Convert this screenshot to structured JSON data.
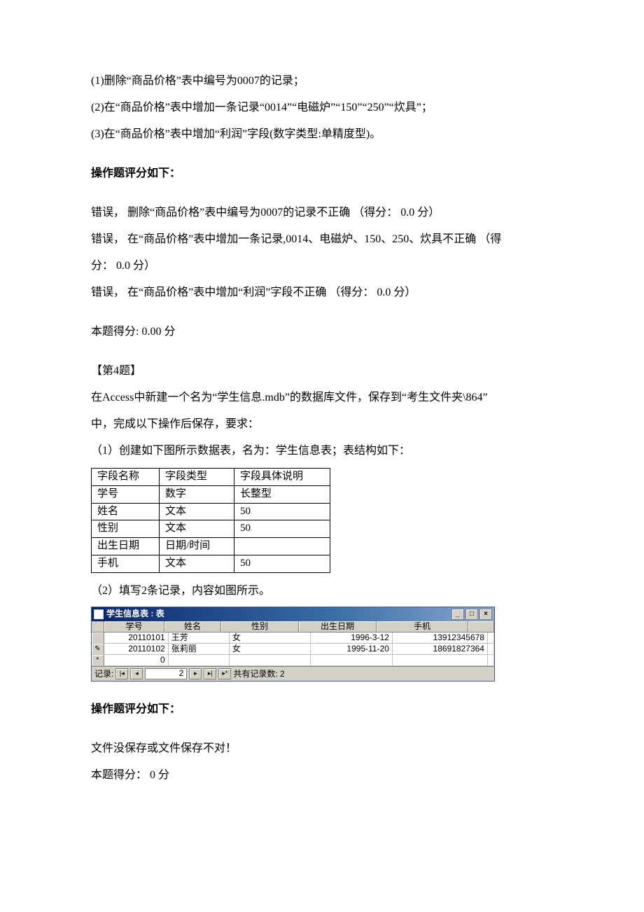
{
  "intro": {
    "l1": "(1)删除“商品价格”表中编号为0007的记录；",
    "l2": "(2)在“商品价格”表中增加一条记录“0014”“电磁炉”“150”“250”“炊具”；",
    "l3": "(3)在“商品价格”表中增加“利润”字段(数字类型:单精度型)。"
  },
  "grade1_hdr": "操作题评分如下：",
  "grade1": {
    "l1": "错误，  删除“商品价格”表中编号为0007的记录不正确  （得分：  0.0 分）",
    "l2a": "错误，  在“商品价格”表中增加一条记录,0014、电磁炉、150、250、炊具不正确  （得",
    "l2b": "分：  0.0 分）",
    "l3": "错误，  在“商品价格”表中增加“利润”字段不正确  （得分：  0.0 分）",
    "score": "本题得分: 0.00 分"
  },
  "q4": {
    "title": "【第4题】",
    "body1": "在Access中新建一个名为“学生信息.mdb”的数据库文件，保存到“考生文件夹\\864”",
    "body2": "中，完成以下操作后保存，要求：",
    "step1": "（1）创建如下图所示数据表，名为：学生信息表；表结构如下：",
    "struct": {
      "h1": "字段名称",
      "h2": "字段类型",
      "h3": "字段具体说明",
      "rows": [
        [
          "学号",
          "数字",
          "长整型"
        ],
        [
          "姓名",
          "文本",
          "50"
        ],
        [
          "性别",
          "文本",
          "50"
        ],
        [
          "出生日期",
          "日期/时间",
          ""
        ],
        [
          "手机",
          "文本",
          "50"
        ]
      ]
    },
    "step2": "（2）填写2条记录，内容如图所示。"
  },
  "win": {
    "title": "学生信息表 : 表",
    "cols": [
      "学号",
      "姓名",
      "性别",
      "出生日期",
      "手机"
    ],
    "rows": [
      {
        "sel": "",
        "学号": "20110101",
        "姓名": "王芳",
        "性别": "女",
        "出生日期": "1996-3-12",
        "手机": "13912345678"
      },
      {
        "sel": "✎",
        "学号": "20110102",
        "姓名": "张莉丽",
        "性别": "女",
        "出生日期": "1995-11-20",
        "手机": "18691827364"
      },
      {
        "sel": "*",
        "学号": "0",
        "姓名": "",
        "性别": "",
        "出生日期": "",
        "手机": ""
      }
    ],
    "nav_label": "记录:",
    "nav_value": "2",
    "nav_total": "共有记录数: 2"
  },
  "grade2_hdr": "操作题评分如下：",
  "grade2": {
    "l1": "文件没保存或文件保存不对！",
    "score": "本题得分：  0 分"
  }
}
